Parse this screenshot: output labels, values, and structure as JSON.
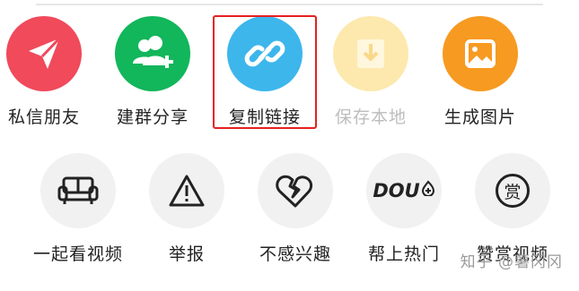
{
  "share_targets": [
    {
      "label": "私信朋友",
      "icon": "send-icon",
      "color": "#f04a5b",
      "state": "normal"
    },
    {
      "label": "建群分享",
      "icon": "group-add-icon",
      "color": "#12b65b",
      "state": "normal"
    },
    {
      "label": "复制链接",
      "icon": "link-icon",
      "color": "#3db6ec",
      "state": "highlighted"
    },
    {
      "label": "保存本地",
      "icon": "download-icon",
      "color": "#fde9ae",
      "state": "disabled"
    },
    {
      "label": "生成图片",
      "icon": "image-icon",
      "color": "#f79a21",
      "state": "normal"
    }
  ],
  "actions": [
    {
      "label": "一起看视频",
      "icon": "sofa-icon"
    },
    {
      "label": "举报",
      "icon": "warning-icon"
    },
    {
      "label": "不感兴趣",
      "icon": "broken-heart-icon"
    },
    {
      "label": "帮上热门",
      "icon": "dou-plus-icon",
      "icon_text": "DOU"
    },
    {
      "label": "赞赏视频",
      "icon": "reward-icon",
      "icon_text": "赏"
    }
  ],
  "highlight_color": "#e52020",
  "watermark": "知乎 @薯冈冈"
}
